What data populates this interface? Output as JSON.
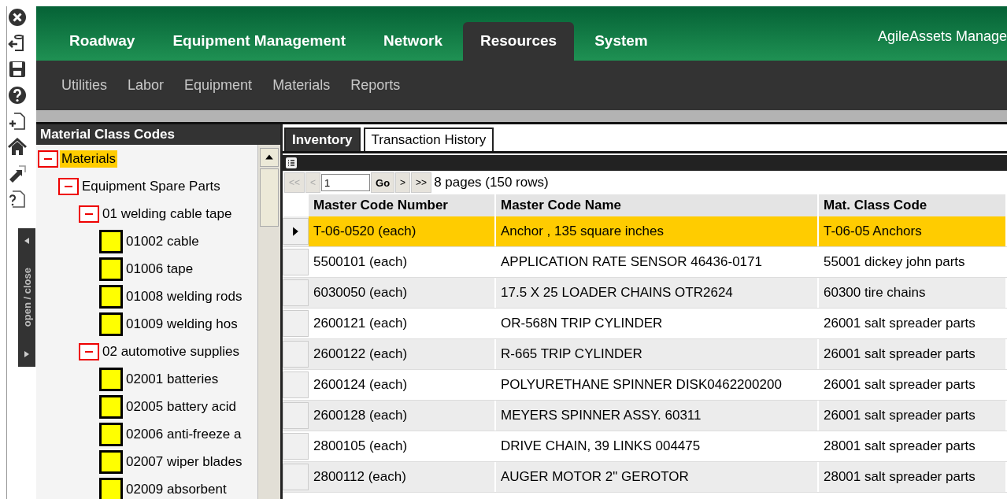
{
  "main_nav": [
    {
      "label": "Roadway",
      "selected": false
    },
    {
      "label": "Equipment Management",
      "selected": false
    },
    {
      "label": "Network",
      "selected": false
    },
    {
      "label": "Resources",
      "selected": true
    },
    {
      "label": "System",
      "selected": false
    }
  ],
  "app_title": "AgileAssets Manage",
  "sub_nav": [
    {
      "label": "Utilities"
    },
    {
      "label": "Labor"
    },
    {
      "label": "Equipment"
    },
    {
      "label": "Materials"
    },
    {
      "label": "Reports"
    }
  ],
  "side_toggle": {
    "label": "open / close"
  },
  "tree": {
    "title": "Material Class Codes",
    "items": [
      {
        "label": "Materials",
        "selected": true,
        "expanded": true,
        "children": [
          {
            "label": "Equipment Spare Parts",
            "selected": false,
            "expanded": true,
            "children": [
              {
                "label": "01 welding cable tape",
                "selected": false,
                "expanded": true,
                "children": [
                  {
                    "label": "01002 cable",
                    "selected": false
                  },
                  {
                    "label": "01006 tape",
                    "selected": false
                  },
                  {
                    "label": "01008 welding rods",
                    "selected": false
                  },
                  {
                    "label": "01009 welding hos",
                    "selected": false
                  }
                ]
              },
              {
                "label": "02 automotive supplies",
                "selected": false,
                "expanded": true,
                "children": [
                  {
                    "label": "02001 batteries",
                    "selected": false
                  },
                  {
                    "label": "02005 battery acid",
                    "selected": false
                  },
                  {
                    "label": "02006 anti-freeze a",
                    "selected": false
                  },
                  {
                    "label": "02007 wiper blades",
                    "selected": false
                  },
                  {
                    "label": "02009 absorbent",
                    "selected": false
                  }
                ]
              }
            ]
          }
        ]
      }
    ]
  },
  "tabs": [
    {
      "label": "Inventory",
      "selected": true
    },
    {
      "label": "Transaction History",
      "selected": false
    }
  ],
  "pager": {
    "buttons_before": [
      {
        "label": "<<",
        "disabled": true
      },
      {
        "label": "<",
        "disabled": true
      }
    ],
    "page": "1",
    "go": "Go",
    "buttons_after": [
      {
        "label": ">",
        "disabled": false
      },
      {
        "label": ">>",
        "disabled": false
      }
    ],
    "summary": "8 pages (150 rows)"
  },
  "table": {
    "columns": [
      "Master Code Number",
      "Master Code Name",
      "Mat. Class Code"
    ],
    "rows": [
      {
        "selected": true,
        "cells": [
          "T-06-0520 (each)",
          "Anchor , 135 square inches",
          "T-06-05 Anchors"
        ]
      },
      {
        "selected": false,
        "cells": [
          "5500101 (each)",
          "APPLICATION RATE SENSOR 46436-0171",
          "55001 dickey john parts"
        ]
      },
      {
        "selected": false,
        "cells": [
          "6030050 (each)",
          "17.5 X 25 LOADER CHAINS OTR2624",
          "60300 tire chains"
        ]
      },
      {
        "selected": false,
        "cells": [
          "2600121 (each)",
          "OR-568N TRIP CYLINDER",
          "26001 salt spreader parts"
        ]
      },
      {
        "selected": false,
        "cells": [
          "2600122 (each)",
          "R-665 TRIP CYLINDER",
          "26001 salt spreader parts"
        ]
      },
      {
        "selected": false,
        "cells": [
          "2600124 (each)",
          "POLYURETHANE SPINNER DISK0462200200",
          "26001 salt spreader parts"
        ]
      },
      {
        "selected": false,
        "cells": [
          "2600128 (each)",
          "MEYERS SPINNER ASSY. 60311",
          "26001 salt spreader parts"
        ]
      },
      {
        "selected": false,
        "cells": [
          "2800105 (each)",
          "DRIVE CHAIN, 39 LINKS 004475",
          "28001 salt spreader parts"
        ]
      },
      {
        "selected": false,
        "cells": [
          "2800112 (each)",
          "AUGER MOTOR 2\" GEROTOR",
          "28001 salt spreader parts"
        ]
      }
    ]
  }
}
